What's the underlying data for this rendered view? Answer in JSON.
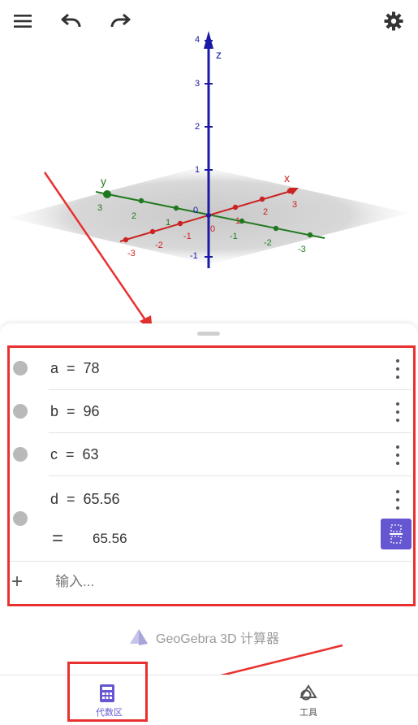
{
  "toolbar": {
    "menu_icon": "menu-icon",
    "undo_icon": "undo-icon",
    "redo_icon": "redo-icon",
    "settings_icon": "gear-icon"
  },
  "graphics": {
    "z_label": "z",
    "x_label": "x",
    "y_label": "y",
    "z_ticks": [
      "4",
      "3",
      "2",
      "1",
      "-1"
    ],
    "x_ticks": [
      "3",
      "2",
      "1",
      "-1",
      "-2",
      "-3"
    ],
    "y_ticks": [
      "3",
      "2",
      "1",
      "-1",
      "-2",
      "-3"
    ],
    "origin_label": "0",
    "colors": {
      "x_axis": "#cc2222",
      "y_axis": "#1f7a1f",
      "z_axis": "#1a1aa6",
      "plane": "#c8c8c8"
    }
  },
  "algebra": {
    "rows": [
      {
        "expr": "a  =  78"
      },
      {
        "expr": "b  =  96"
      },
      {
        "expr": "c  =  63"
      },
      {
        "expr": "d  =  65.56",
        "result_symbol": "=",
        "result": "65.56"
      }
    ],
    "input_placeholder": "输入..."
  },
  "brand": "GeoGebra 3D 计算器",
  "tabs": [
    {
      "label": "代数区",
      "active": true
    },
    {
      "label": "工具",
      "active": false
    }
  ],
  "colors": {
    "accent": "#6557d2",
    "annotation_red": "#e8312f"
  }
}
